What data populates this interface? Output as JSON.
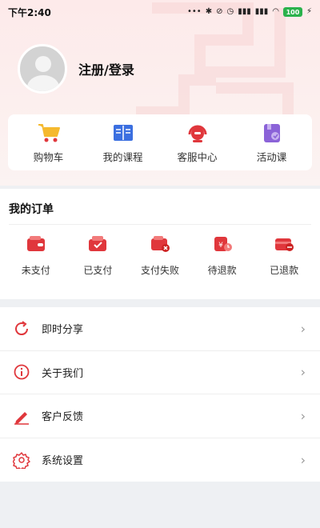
{
  "status_bar": {
    "time": "下午2:40",
    "icons": [
      "dots-icon",
      "bluetooth-icon",
      "mute-icon",
      "alarm-icon",
      "signal-icon",
      "signal-icon",
      "wifi-icon"
    ],
    "battery": "100"
  },
  "profile": {
    "login_label": "注册/登录"
  },
  "quick_menu": [
    {
      "label": "购物车",
      "icon": "cart-icon"
    },
    {
      "label": "我的课程",
      "icon": "book-icon"
    },
    {
      "label": "客服中心",
      "icon": "headset-icon"
    },
    {
      "label": "活动课",
      "icon": "activity-icon"
    }
  ],
  "orders": {
    "title": "我的订单",
    "items": [
      {
        "label": "未支付",
        "icon": "wallet-unpaid-icon"
      },
      {
        "label": "已支付",
        "icon": "wallet-paid-icon"
      },
      {
        "label": "支付失败",
        "icon": "wallet-failed-icon"
      },
      {
        "label": "待退款",
        "icon": "refund-pending-icon"
      },
      {
        "label": "已退款",
        "icon": "refunded-icon"
      }
    ]
  },
  "menu": [
    {
      "label": "即时分享",
      "icon": "share-icon"
    },
    {
      "label": "关于我们",
      "icon": "info-icon"
    },
    {
      "label": "客户反馈",
      "icon": "feedback-pen-icon"
    },
    {
      "label": "系统设置",
      "icon": "settings-icon"
    }
  ],
  "colors": {
    "accent": "#e0373c",
    "cart_yellow": "#f5b92e",
    "book_blue": "#3b6fe0",
    "activity_purple": "#8b63d8"
  }
}
